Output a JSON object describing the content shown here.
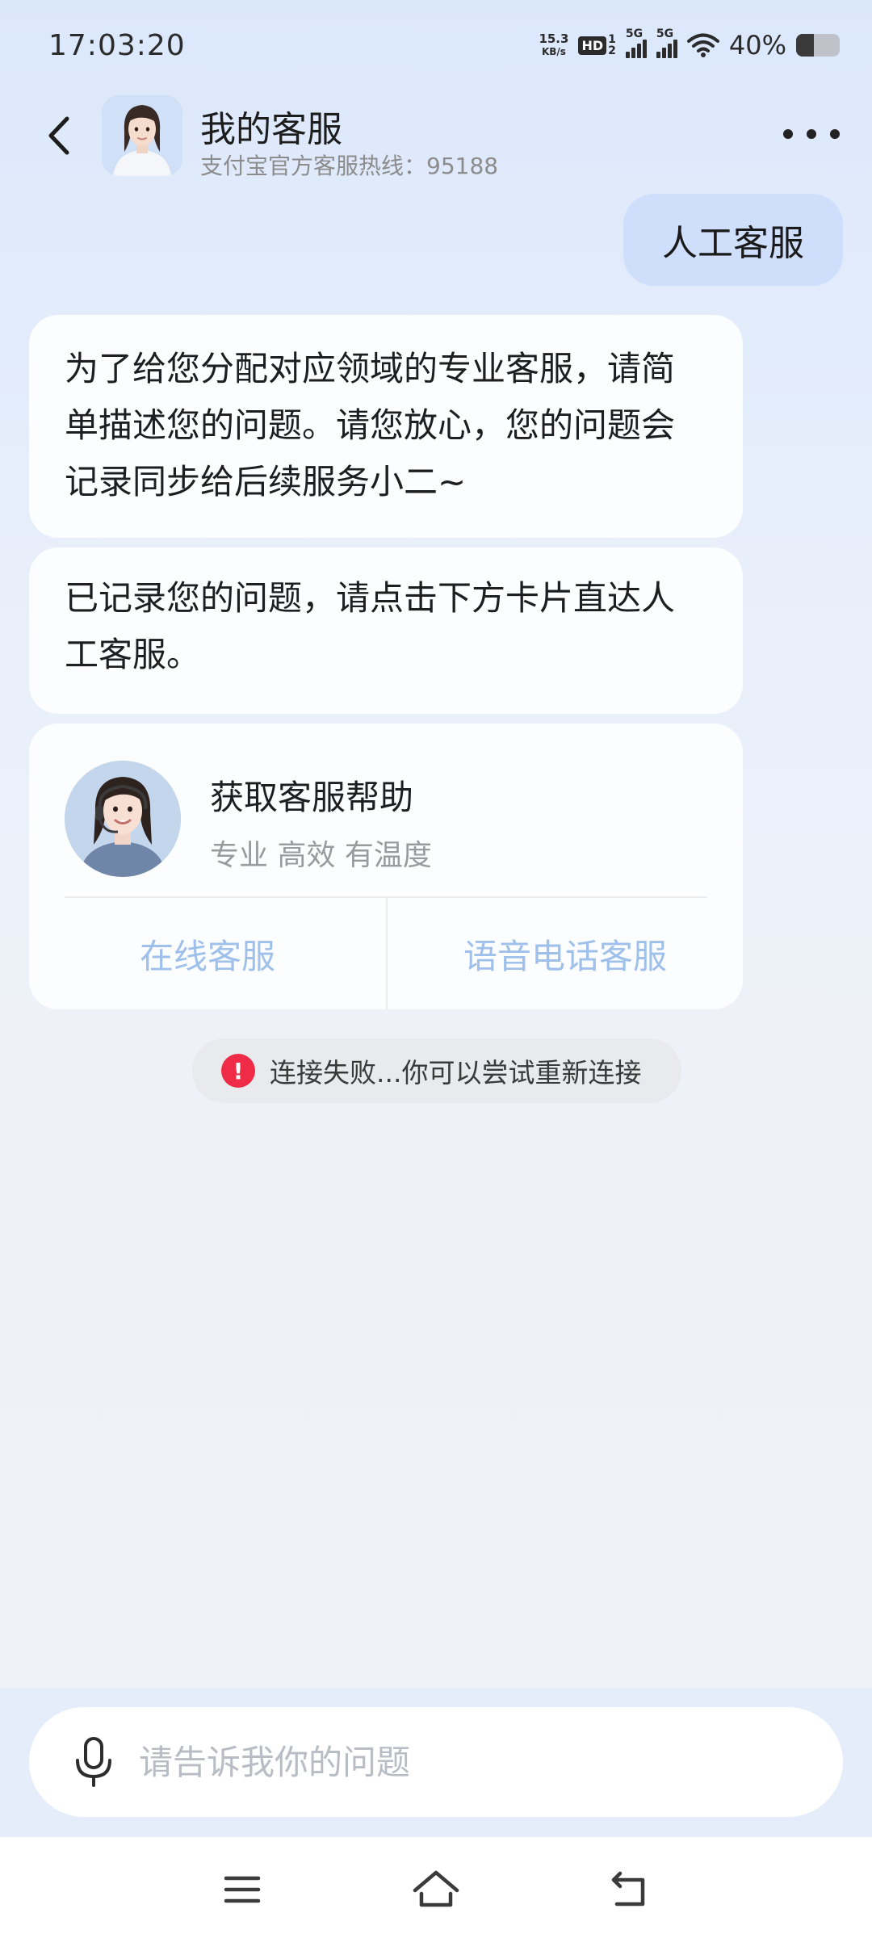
{
  "status_bar": {
    "time": "17:03:20",
    "net_speed_value": "15.3",
    "net_speed_unit": "KB/s",
    "hd_label": "HD",
    "hd_sim_top": "1",
    "hd_sim_bottom": "2",
    "signal_1_label": "5G",
    "signal_2_label": "5G",
    "battery_percent": "40%",
    "battery_level": 0.4
  },
  "header": {
    "title": "我的客服",
    "subtitle": "支付宝官方客服热线：95188"
  },
  "messages": {
    "user_message": "人工客服",
    "bot_message_1": "为了给您分配对应领域的专业客服，请简单描述您的问题。请您放心，您的问题会记录同步给后续服务小二~",
    "bot_message_2": "已记录您的问题，请点击下方卡片直达人工客服。"
  },
  "service_card": {
    "title": "获取客服帮助",
    "subtitle": "专业 高效 有温度",
    "online_button": "在线客服",
    "voice_button": "语音电话客服"
  },
  "connection": {
    "error_icon": "!",
    "error_text": "连接失败...你可以尝试重新连接"
  },
  "input": {
    "placeholder": "请告诉我你的问题"
  },
  "icons": {
    "back": "chevron-left-icon",
    "more": "more-dots-icon",
    "mic": "microphone-icon",
    "nav_menu": "menu-icon",
    "nav_home": "home-icon",
    "nav_back": "back-arrow-icon"
  },
  "colors": {
    "user_bubble": "#cfdefb",
    "card_button_text": "#9fc0ea",
    "error_icon": "#f02b47"
  }
}
